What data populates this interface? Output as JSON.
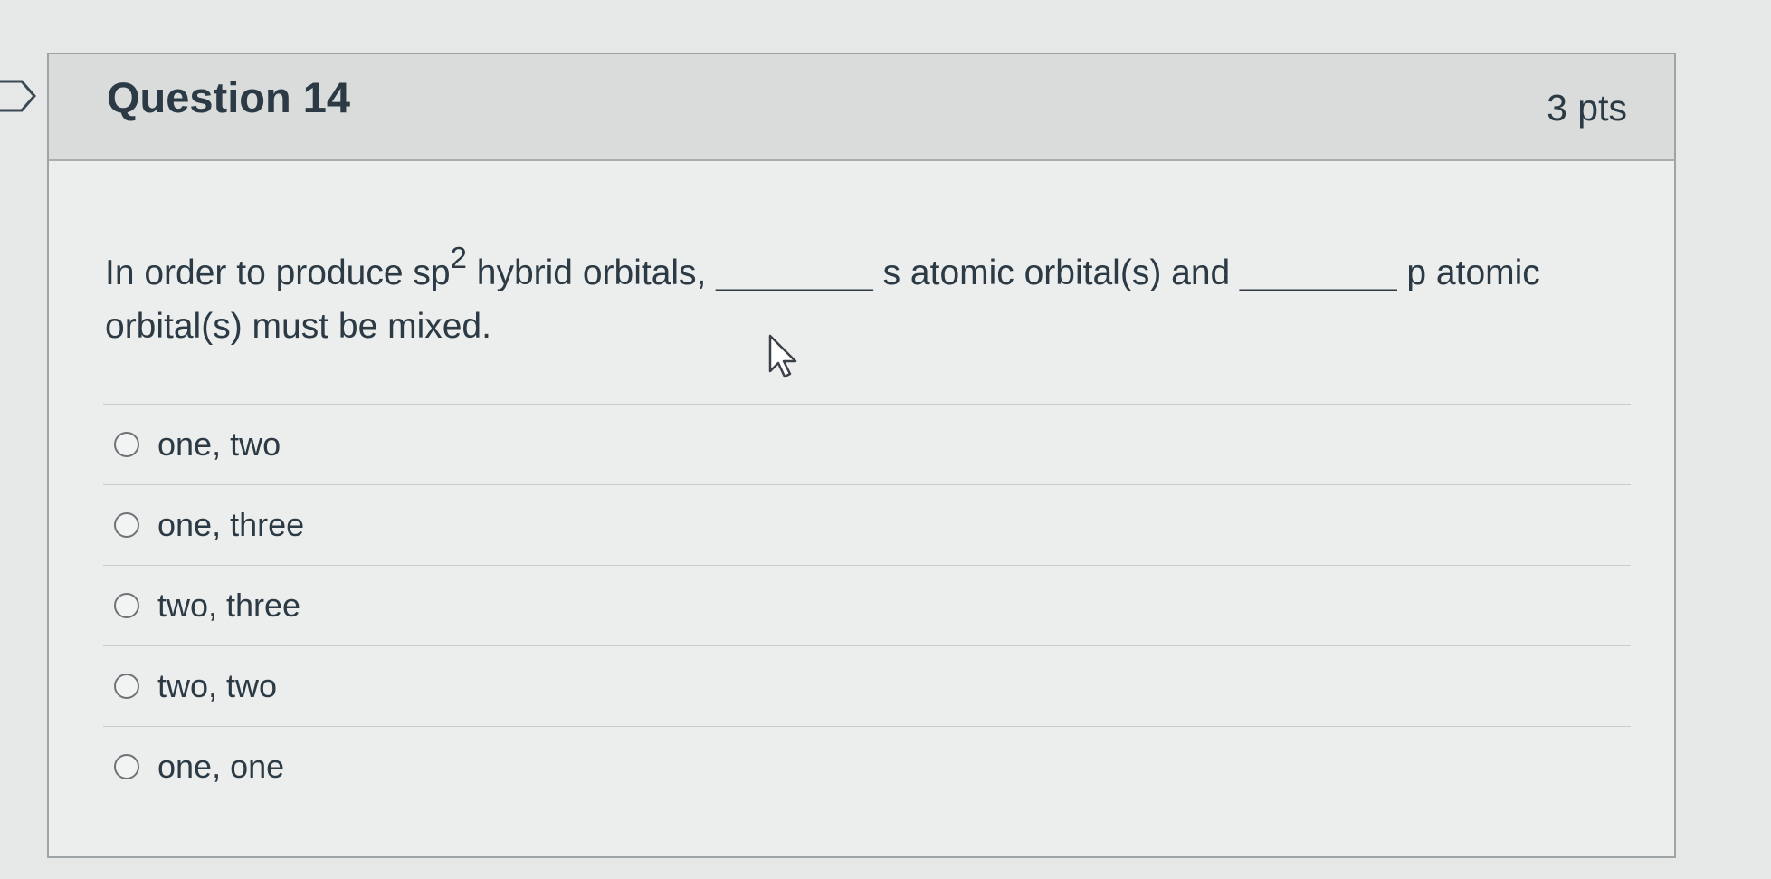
{
  "question": {
    "title": "Question 14",
    "points": "3 pts",
    "text_before_sup": "In order to produce sp",
    "superscript": "2",
    "text_after_sup": " hybrid orbitals, ________ s atomic orbital(s) and ________ p atomic orbital(s) must be mixed."
  },
  "answers": [
    {
      "label": "one, two"
    },
    {
      "label": "one, three"
    },
    {
      "label": "two, three"
    },
    {
      "label": "two, two"
    },
    {
      "label": "one, one"
    }
  ],
  "icons": {
    "flag": "flag-icon",
    "radio": "radio-icon",
    "cursor": "mouse-cursor-icon"
  }
}
